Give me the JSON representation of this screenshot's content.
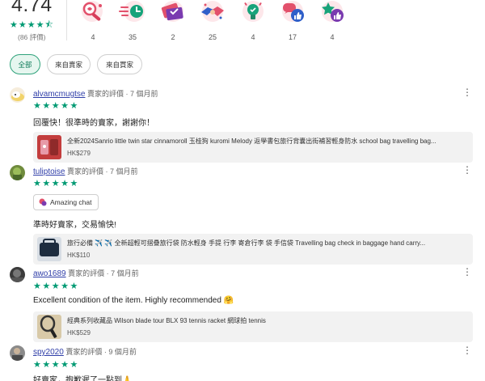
{
  "summary": {
    "score": "4.74",
    "stars": "★★★★⯪",
    "count": "(86 評價)",
    "badges": [
      {
        "icon": "magnifier-heart-icon",
        "count": "4"
      },
      {
        "icon": "fast-clock-icon",
        "count": "35"
      },
      {
        "icon": "ticket-icon",
        "count": "2"
      },
      {
        "icon": "handshake-icon",
        "count": "25"
      },
      {
        "icon": "lightbulb-icon",
        "count": "4"
      },
      {
        "icon": "chat-thumbs-up-icon",
        "count": "17"
      },
      {
        "icon": "star-thumbs-up-icon",
        "count": "4"
      }
    ]
  },
  "filters": [
    "全部",
    "來自賣家",
    "來自買家"
  ],
  "reviews": [
    {
      "user": "alvamcmugtse",
      "meta": "賣家的評價 · 7 個月前",
      "stars": "★★★★★",
      "text": "回覆快！很準時的賣家，謝謝你！",
      "product_title": "全新2024Sanrio little twin star cinnamoroll 玉桂狗 kuromi Melody 返學書包旅行背囊出街補習輕身防水 school bag travelling bag...",
      "product_price": "HK$279"
    },
    {
      "user": "tuliptoise",
      "meta": "賣家的評價 · 7 個月前",
      "stars": "★★★★★",
      "tag": "Amazing chat",
      "text": "準時好賣家，交易愉快!",
      "product_title": "旅行必備 ✈️ ✈️ 全新超輕可摺疊旅行袋 防水輕身 手提 行李 寄倉行李 袋 手信袋 Travelling bag check in baggage hand carry...",
      "product_price": "HK$110"
    },
    {
      "user": "awo1689",
      "meta": "賣家的評價 · 7 個月前",
      "stars": "★★★★★",
      "text": "Excellent condition of the item. Highly recommended 🤗",
      "product_title": "經典系列收藏品 Wilson blade tour BLX 93 tennis racket 網球拍 tennis",
      "product_price": "HK$529"
    },
    {
      "user": "spy2020",
      "meta": "賣家的評價 · 9 個月前",
      "stars": "★★★★★",
      "text": "好賣家，抱歉遲了一點到🙏"
    }
  ],
  "more_icon": "⋮",
  "colors": {
    "star": "#009a73",
    "link": "#2f3ea8",
    "chip_active_bg": "#e6f6ef",
    "chip_active_border": "#2fa27b"
  }
}
